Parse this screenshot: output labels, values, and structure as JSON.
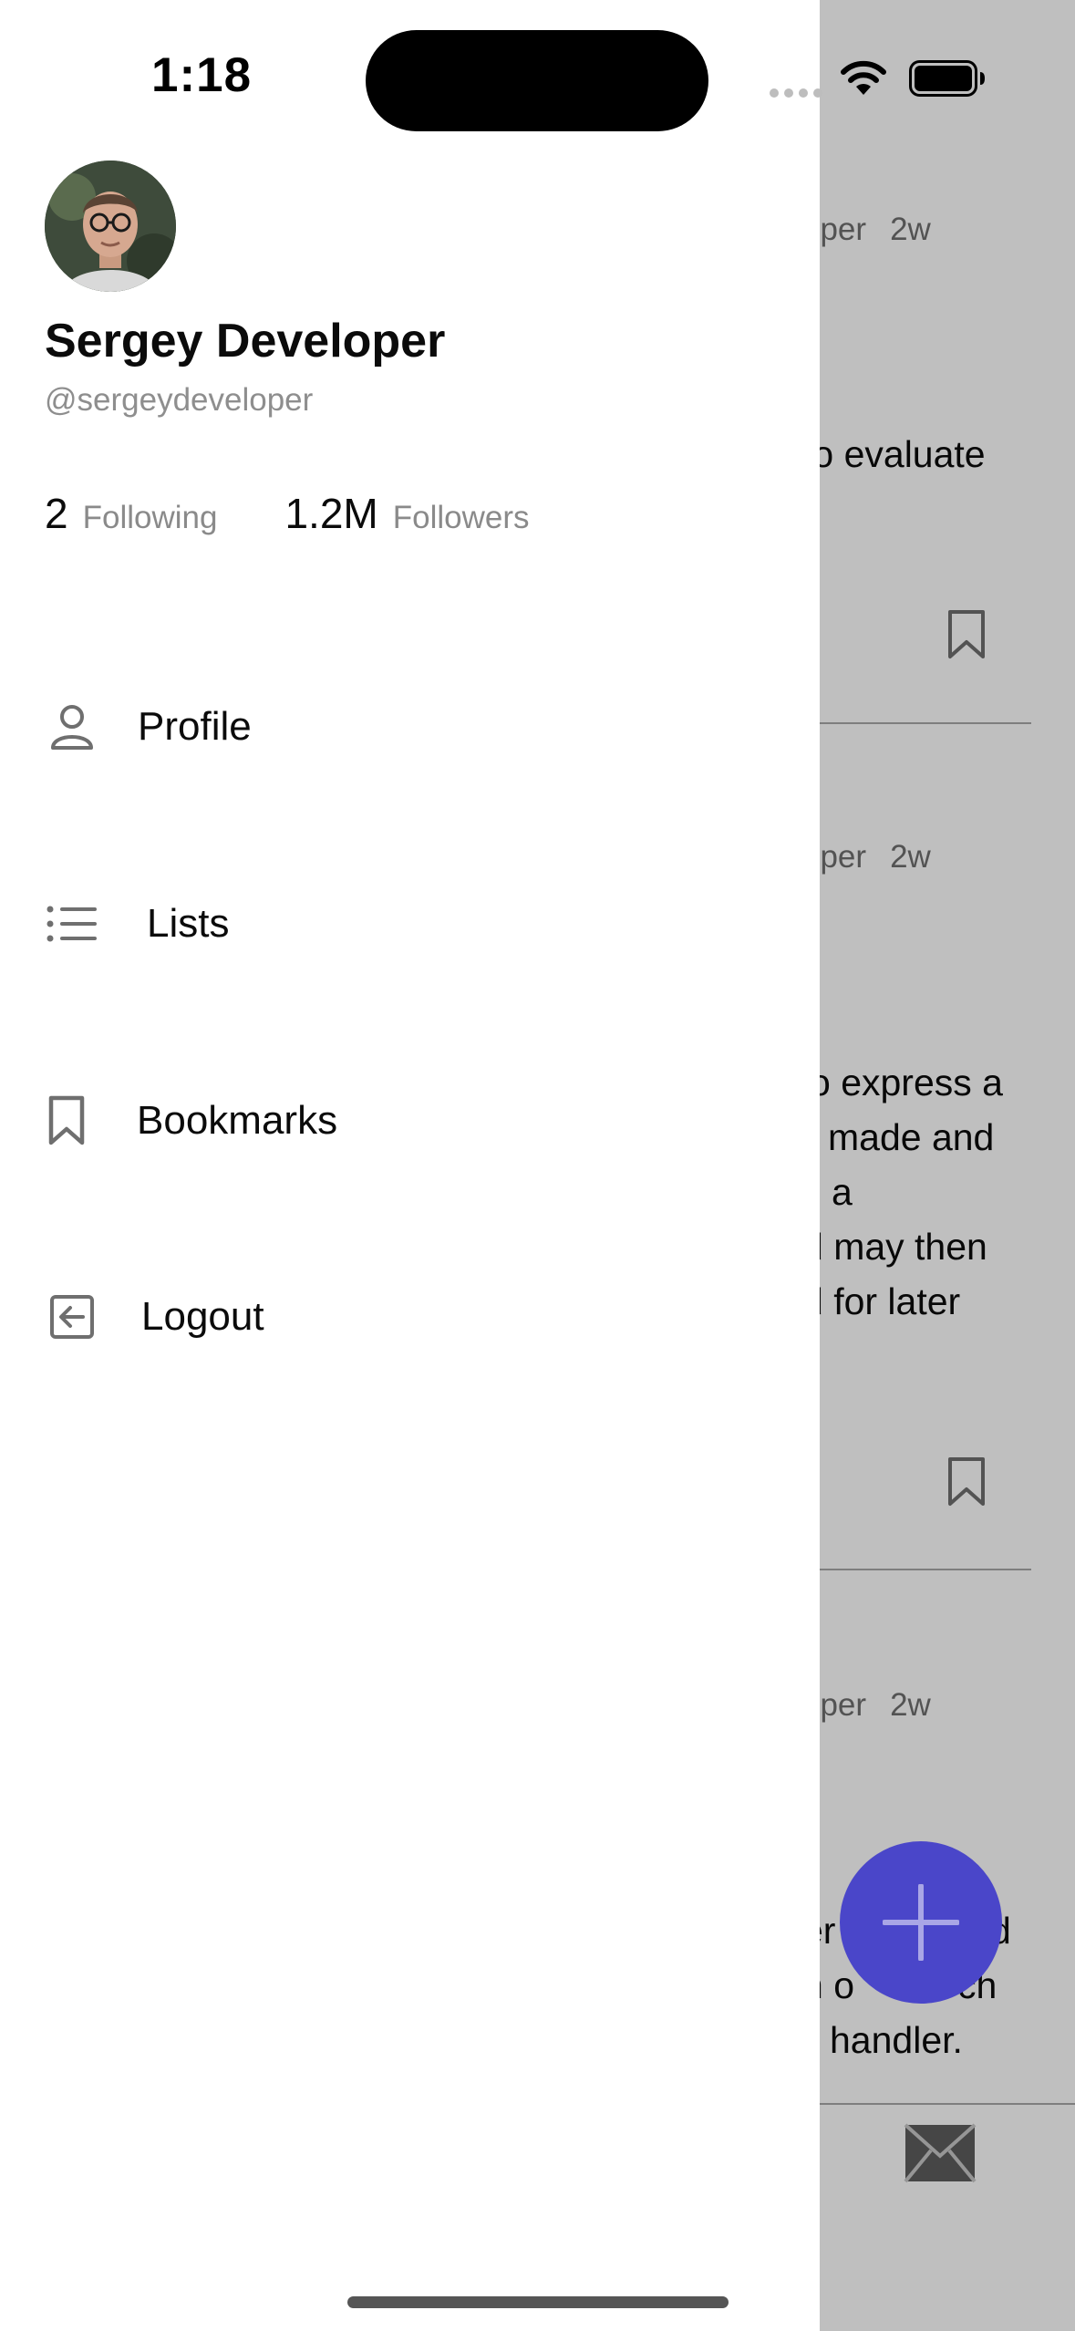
{
  "status_bar": {
    "time": "1:18"
  },
  "drawer": {
    "user": {
      "name": "Sergey Developer",
      "handle": "@sergeydeveloper",
      "avatar_icon": "profile-photo"
    },
    "stats": {
      "following_count": "2",
      "following_label": "Following",
      "followers_count": "1.2M",
      "followers_label": "Followers"
    },
    "menu": {
      "profile": {
        "label": "Profile",
        "icon": "person-icon"
      },
      "lists": {
        "label": "Lists",
        "icon": "list-icon"
      },
      "bookmarks": {
        "label": "Bookmarks",
        "icon": "bookmark-icon"
      },
      "logout": {
        "label": "Logout",
        "icon": "logout-icon"
      }
    }
  },
  "background_feed": {
    "posts": [
      {
        "author_fragment": "oper",
        "age": "2w",
        "text_lines": [
          "to evaluate"
        ]
      },
      {
        "author_fragment": "oper",
        "age": "2w",
        "text_lines": [
          "o express a",
          "made and",
          "a",
          "d may then",
          "d for later"
        ]
      },
      {
        "author_fragment": "oper",
        "age": "2w",
        "text_lines": [
          "er",
          "d",
          "h o",
          "ch",
          "handler."
        ]
      }
    ]
  },
  "colors": {
    "accent": "#4a46c9",
    "overlay": "rgba(0,0,0,0.25)",
    "secondary_text": "#8e8e8e"
  },
  "fab": {
    "icon": "plus-icon"
  },
  "tab_bar": {
    "icon": "mail-icon"
  }
}
